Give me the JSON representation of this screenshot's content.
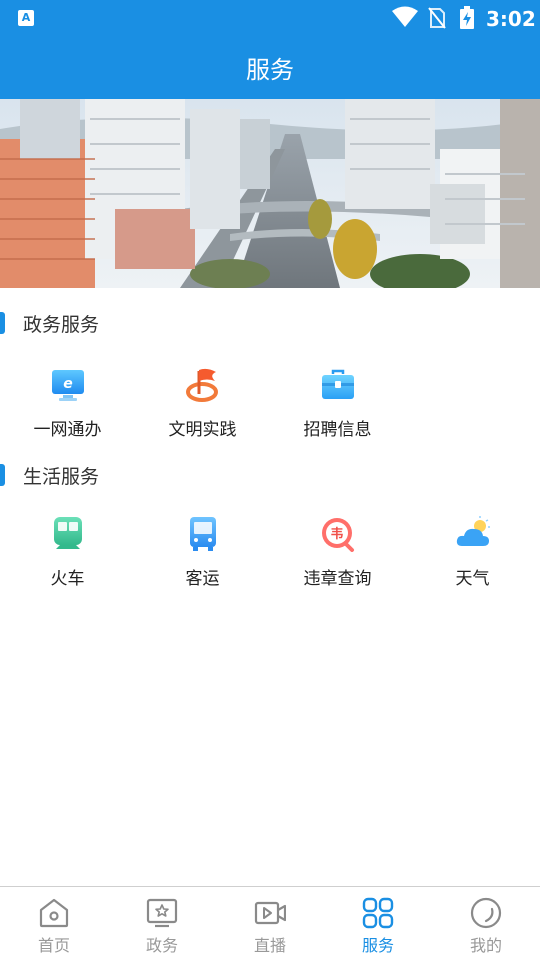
{
  "status_bar": {
    "app_badge": "A",
    "time": "3:02"
  },
  "header": {
    "title": "服务"
  },
  "sections": [
    {
      "title": "政务服务",
      "items": [
        {
          "label": "一网通办",
          "icon": "monitor-e-icon"
        },
        {
          "label": "文明实践",
          "icon": "flag-icon"
        },
        {
          "label": "招聘信息",
          "icon": "briefcase-icon"
        }
      ]
    },
    {
      "title": "生活服务",
      "items": [
        {
          "label": "火车",
          "icon": "train-icon"
        },
        {
          "label": "客运",
          "icon": "bus-icon"
        },
        {
          "label": "违章查询",
          "icon": "violation-icon"
        },
        {
          "label": "天气",
          "icon": "weather-icon"
        }
      ]
    }
  ],
  "bottom_nav": [
    {
      "label": "首页",
      "icon": "home-icon"
    },
    {
      "label": "政务",
      "icon": "government-icon"
    },
    {
      "label": "直播",
      "icon": "live-icon"
    },
    {
      "label": "服务",
      "icon": "services-grid-icon",
      "active": true
    },
    {
      "label": "我的",
      "icon": "profile-icon"
    }
  ],
  "colors": {
    "accent": "#1a8fe3",
    "inactive": "#999999"
  }
}
